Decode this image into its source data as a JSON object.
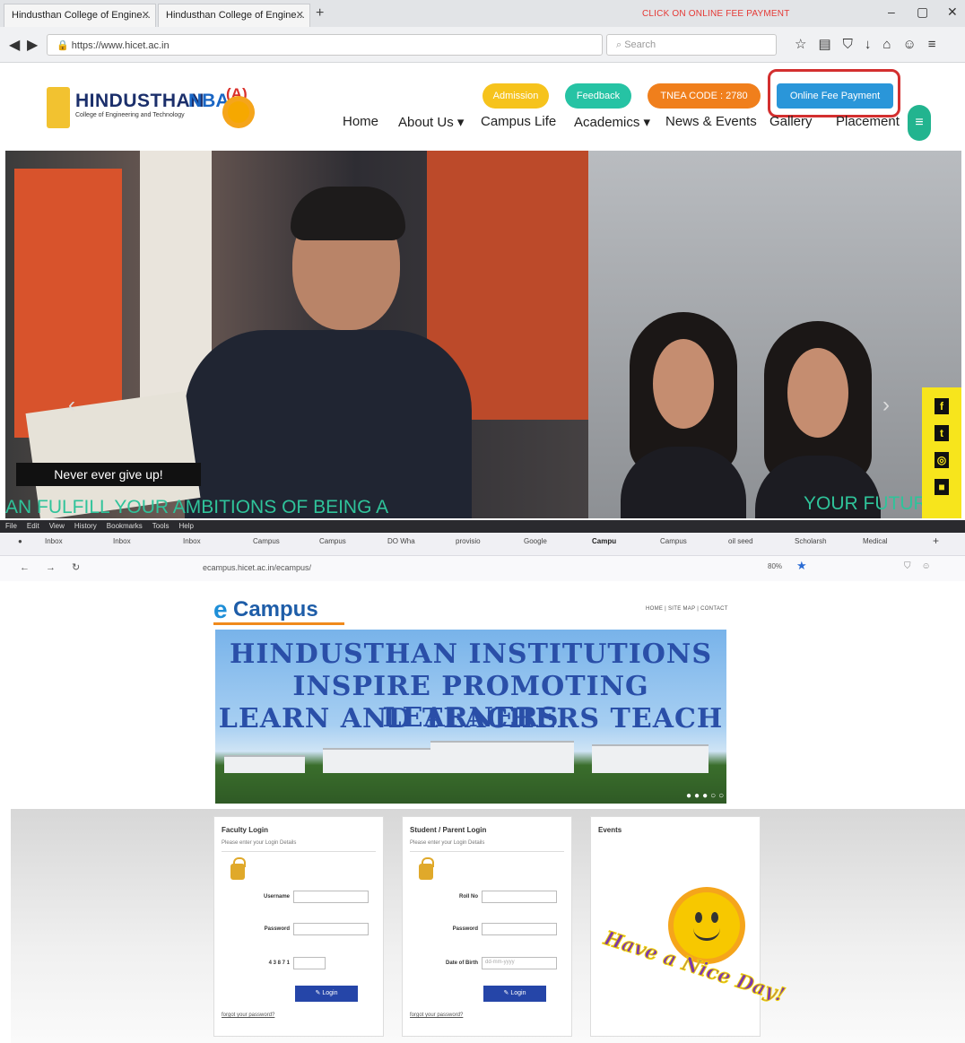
{
  "top_browser": {
    "tabs": [
      {
        "label": "Hindusthan College of Engine..."
      },
      {
        "label": "Hindusthan College of Engine..."
      }
    ],
    "new_tab_label": "+",
    "instruction_note": "CLICK ON ONLINE FEE PAYMENT",
    "window_controls": [
      "–",
      "▢",
      "✕"
    ],
    "url": "https://www.hicet.ac.in",
    "search_placeholder": "Search",
    "site": {
      "logo_title": "HINDUSTHAN",
      "logo_subtitle": "College of Engineering and Technology",
      "nbr_text": "NBA",
      "naac_grade": "(A)",
      "pill_buttons": [
        {
          "label": "Admission",
          "color": "#f6c31c"
        },
        {
          "label": "Feedback",
          "color": "#26c3a4"
        },
        {
          "label": "TNEA CODE : 2780",
          "color": "#f07f1c"
        },
        {
          "label": "Online Fee Payment",
          "color": "#2a96d9"
        }
      ],
      "menu": [
        "Home",
        "About Us ▾",
        "Campus Life",
        "Academics ▾",
        "News & Events",
        "Gallery",
        "Placement"
      ],
      "hero": {
        "caption": "Never ever give up!",
        "tagline_left": "AN FULFILL YOUR AMBITIONS OF BEING A",
        "tagline_right": "YOUR FUTURE",
        "prev": "‹",
        "next": "›"
      },
      "social": [
        "f",
        "t",
        "◎",
        "■"
      ]
    }
  },
  "bottom_browser": {
    "menubar": [
      "File",
      "Edit",
      "View",
      "History",
      "Bookmarks",
      "Tools",
      "Help"
    ],
    "tabs": [
      "Inbox",
      "Inbox",
      "Inbox",
      "Campus",
      "Campus",
      "DO Wha",
      "provisio",
      "Google",
      "Campu",
      "Campus",
      "oil seed",
      "Scholarsh",
      "Medical"
    ],
    "active_tab_index": 8,
    "url": "ecampus.hicet.ac.in/ecampus/",
    "zoom": "80%",
    "ecampus_logo": "Campus",
    "ecampus_links": "HOME  |  SITE MAP  |  CONTACT",
    "banner_lines": [
      "HINDUSTHAN INSTITUTIONS",
      "INSPIRE PROMOTING LEARNERS",
      "LEARN AND TEACHERS TEACH"
    ],
    "faculty": {
      "title": "Faculty Login",
      "subtitle": "Please enter your Login Details",
      "username_label": "Username",
      "password_label": "Password",
      "captcha_label": "4 3 8 7 1",
      "login": "✎ Login",
      "forgot": "forgot your password?"
    },
    "student": {
      "title": "Student / Parent Login",
      "subtitle": "Please enter your Login Details",
      "rollno_label": "Roll No",
      "password_label": "Password",
      "dob_label": "Date of Birth",
      "dob_placeholder": "dd-mm-yyyy",
      "login": "✎ Login",
      "forgot": "forgot your password?"
    },
    "events": {
      "title": "Events",
      "greeting": "Have a Nice Day!"
    }
  }
}
